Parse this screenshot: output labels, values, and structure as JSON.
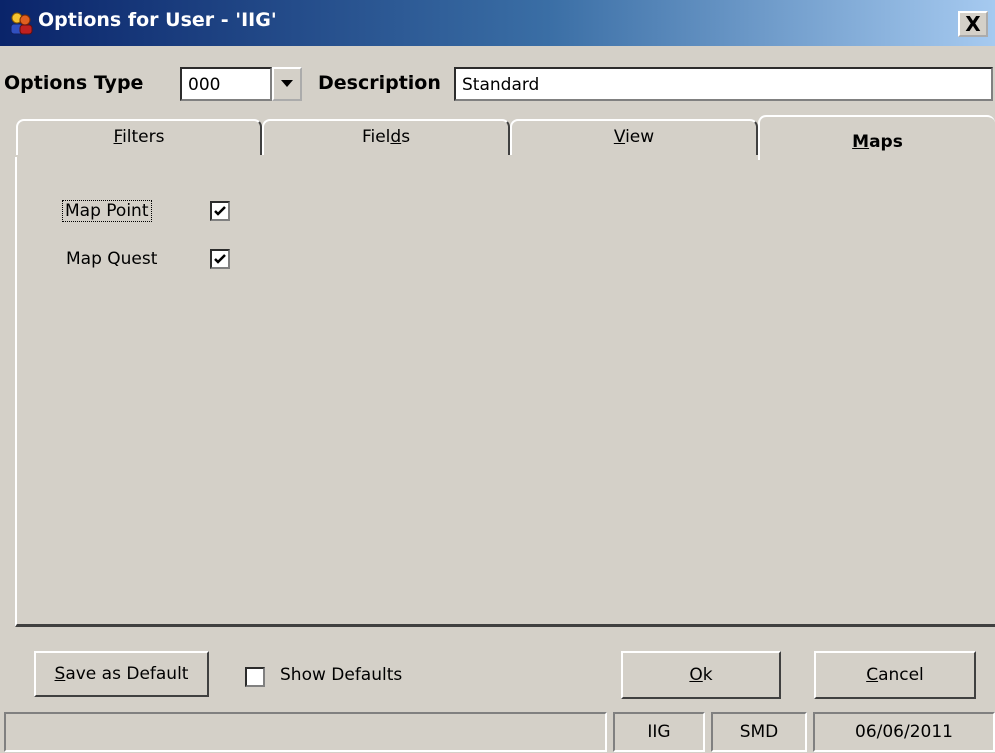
{
  "window": {
    "title": "Options for User - 'IIG'",
    "close_label": "X"
  },
  "options_type": {
    "label": "Options Type",
    "value": "000"
  },
  "description": {
    "label": "Description",
    "value": "Standard"
  },
  "tabs": [
    {
      "label_pre": "",
      "label_u": "F",
      "label_post": "ilters"
    },
    {
      "label_pre": "Fiel",
      "label_u": "d",
      "label_post": "s"
    },
    {
      "label_pre": "",
      "label_u": "V",
      "label_post": "iew"
    },
    {
      "label_pre": "",
      "label_u": "M",
      "label_post": "aps",
      "active": true
    }
  ],
  "maps_tab": {
    "map_point": {
      "label": "Map Point",
      "checked": true
    },
    "map_quest": {
      "label": "Map Quest",
      "checked": true
    }
  },
  "buttons": {
    "save_default": {
      "u": "S",
      "rest": "ave as Default"
    },
    "ok": {
      "u": "O",
      "rest": "k"
    },
    "cancel": {
      "u": "C",
      "rest": "ancel"
    }
  },
  "show_defaults": {
    "label": "Show Defaults",
    "checked": false
  },
  "status": {
    "main": "",
    "user": "IIG",
    "code": "SMD",
    "date": "06/06/2011"
  }
}
